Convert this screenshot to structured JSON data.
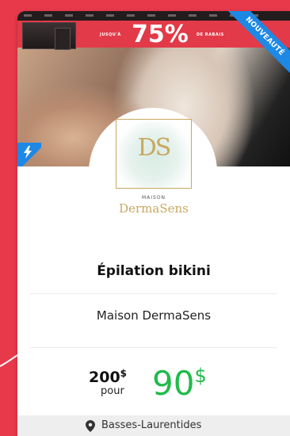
{
  "promo": {
    "prefix": "JUSQU'À",
    "percent": "75%",
    "suffix": "DE RABAIS"
  },
  "badge": {
    "ribbon_text": "NOUVEAUTÉ",
    "flash_icon": "lightning-icon"
  },
  "logo": {
    "monogram": "DS",
    "maison": "MAISON",
    "name": "DermaSens"
  },
  "deal": {
    "title": "Épilation bikini",
    "merchant": "Maison DermaSens",
    "old_price": "200",
    "old_currency": "$",
    "pour": "pour",
    "new_price": "90",
    "new_currency": "$"
  },
  "footer": {
    "location_icon": "map-pin-icon",
    "location": "Basses-Laurentides"
  },
  "colors": {
    "background": "#e8394b",
    "ribbon_blue": "#1e88e5",
    "price_green": "#1fbb4a",
    "logo_gold": "#c8a860"
  }
}
